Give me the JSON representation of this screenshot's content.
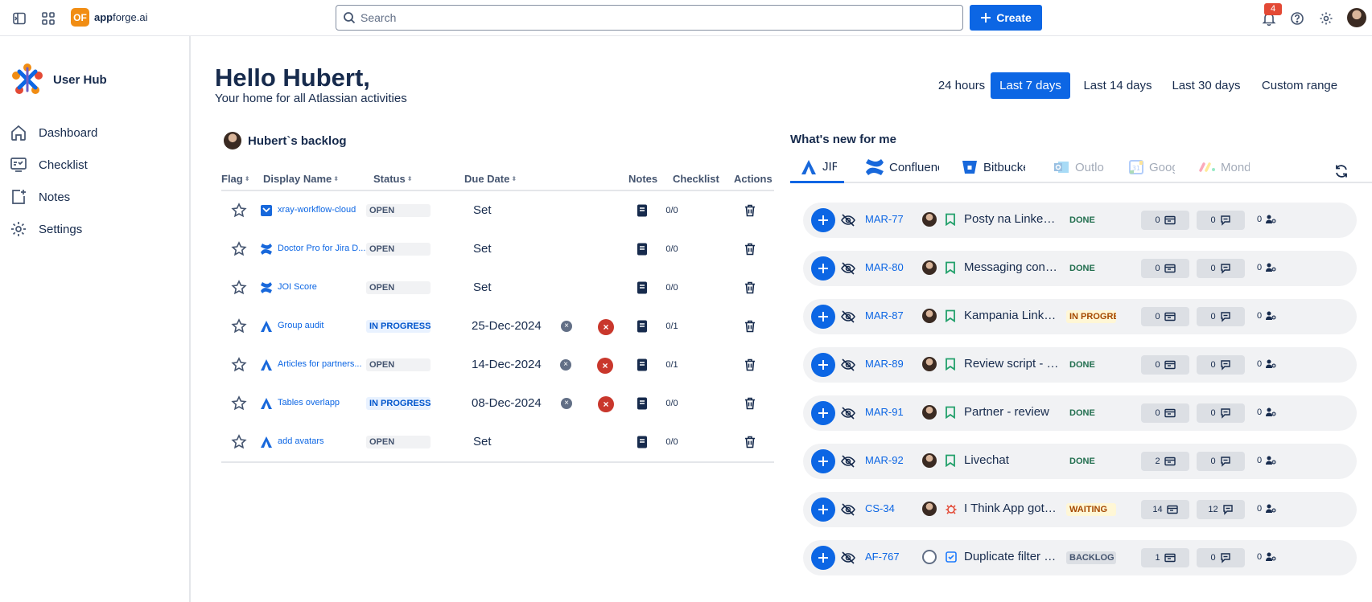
{
  "topbar": {
    "brand": {
      "bold": "app",
      "rest": "forge.ai",
      "logo_glyph": "OF"
    },
    "search_placeholder": "Search",
    "create_label": "Create",
    "notifications_count": "4",
    "icons": [
      "sidebar-toggle-icon",
      "app-switcher-icon",
      "bell-icon",
      "help-icon",
      "gear-icon"
    ]
  },
  "sidebar": {
    "title": "User Hub",
    "items": [
      {
        "label": "Dashboard",
        "icon": "home-icon"
      },
      {
        "label": "Checklist",
        "icon": "checklist-icon"
      },
      {
        "label": "Notes",
        "icon": "notes-icon"
      },
      {
        "label": "Settings",
        "icon": "gear-icon"
      }
    ]
  },
  "header": {
    "greeting": "Hello Hubert,",
    "subtitle": "Your home for all Atlassian activities",
    "ranges": [
      "24 hours",
      "Last 7 days",
      "Last 14 days",
      "Last 30 days",
      "Custom range"
    ],
    "active_range": "Last 7 days"
  },
  "backlog": {
    "title": "Hubert`s backlog",
    "columns": [
      "Flag",
      "Display Name",
      "Status",
      "Due Date",
      "Notes",
      "Checklist",
      "Actions"
    ],
    "rows": [
      {
        "type": "xray",
        "name": "xray-workflow-cloud",
        "status": "OPEN",
        "due": "Set",
        "checklist": "0/0"
      },
      {
        "type": "confluence",
        "name": "Doctor Pro for Jira D...",
        "status": "OPEN",
        "due": "Set",
        "checklist": "0/0"
      },
      {
        "type": "confluence",
        "name": "JOI Score",
        "status": "OPEN",
        "due": "Set",
        "checklist": "0/0"
      },
      {
        "type": "jira",
        "name": "Group audit",
        "status": "IN PROGRESS",
        "due": "25-Dec-2024",
        "checklist": "0/1"
      },
      {
        "type": "jira",
        "name": "Articles for partners...",
        "status": "OPEN",
        "due": "14-Dec-2024",
        "checklist": "0/1"
      },
      {
        "type": "jira",
        "name": "Tables overlapp",
        "status": "IN PROGRESS",
        "due": "08-Dec-2024",
        "checklist": "0/0"
      },
      {
        "type": "jira",
        "name": "add avatars",
        "status": "OPEN",
        "due": "Set",
        "checklist": "0/0"
      }
    ]
  },
  "whats_new": {
    "title": "What's new for me",
    "tabs": [
      "JIRA",
      "Confluence",
      "Bitbucket",
      "Outlook",
      "Google",
      "Monday"
    ],
    "active_tab": "JIRA",
    "rows": [
      {
        "key": "MAR-77",
        "type": "story",
        "title": "Posty na LinkedIn",
        "status": "DONE",
        "status_class": "s-done",
        "attachments": "0",
        "comments": "0",
        "watchers": "0",
        "avatar": "photo"
      },
      {
        "key": "MAR-80",
        "type": "story",
        "title": "Messaging concept",
        "status": "DONE",
        "status_class": "s-done",
        "attachments": "0",
        "comments": "0",
        "watchers": "0",
        "avatar": "photo"
      },
      {
        "key": "MAR-87",
        "type": "story",
        "title": "Kampania LinkedIn",
        "status": "IN PROGRESS",
        "status_class": "s-prog",
        "attachments": "0",
        "comments": "0",
        "watchers": "0",
        "avatar": "photo"
      },
      {
        "key": "MAR-89",
        "type": "story",
        "title": "Review script - video",
        "status": "DONE",
        "status_class": "s-done",
        "attachments": "0",
        "comments": "0",
        "watchers": "0",
        "avatar": "photo"
      },
      {
        "key": "MAR-91",
        "type": "story",
        "title": "Partner - review",
        "status": "DONE",
        "status_class": "s-done",
        "attachments": "0",
        "comments": "0",
        "watchers": "0",
        "avatar": "photo"
      },
      {
        "key": "MAR-92",
        "type": "story",
        "title": "Livechat",
        "status": "DONE",
        "status_class": "s-done",
        "attachments": "2",
        "comments": "0",
        "watchers": "0",
        "avatar": "photo"
      },
      {
        "key": "CS-34",
        "type": "bug",
        "title": "I Think App got stuck",
        "status": "WAITING",
        "status_class": "s-wait",
        "attachments": "14",
        "comments": "12",
        "watchers": "0",
        "avatar": "photo"
      },
      {
        "key": "AF-767",
        "type": "task",
        "title": "Duplicate filter applied",
        "status": "BACKLOG",
        "status_class": "s-back",
        "attachments": "1",
        "comments": "0",
        "watchers": "0",
        "avatar": "empty"
      }
    ]
  },
  "colors": {
    "primary": "#0c66e4",
    "text": "#172b4d",
    "danger": "#c9372c",
    "done": "#216e4e"
  }
}
